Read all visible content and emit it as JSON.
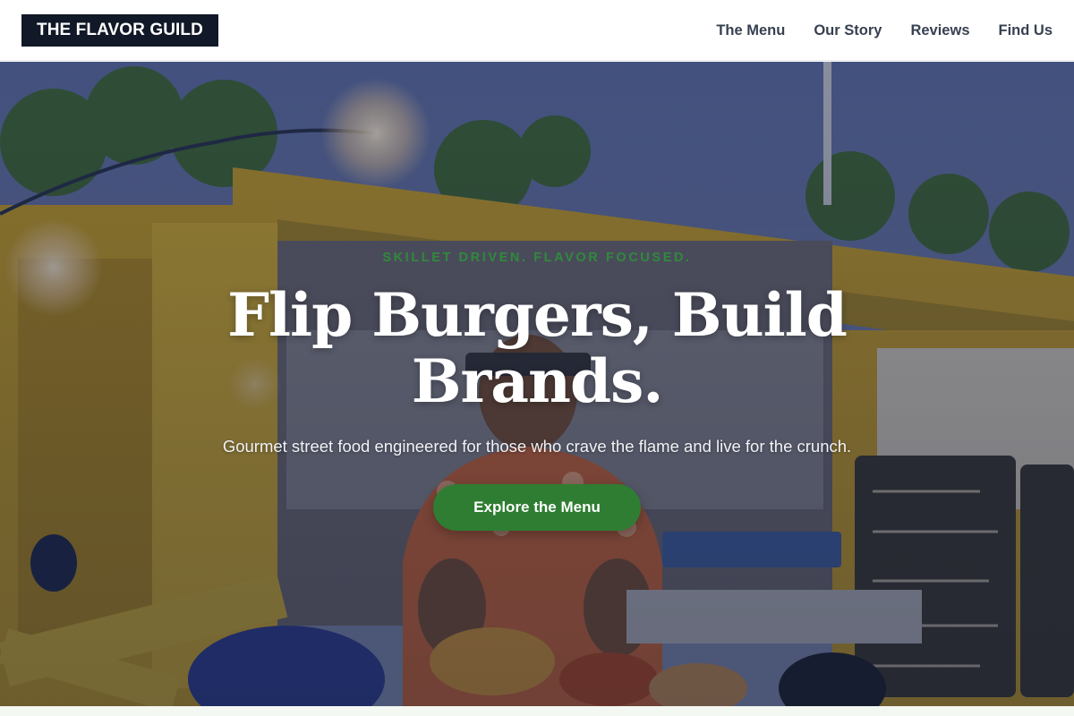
{
  "header": {
    "logo": "THE FLAVOR GUILD",
    "nav": [
      {
        "label": "The Menu"
      },
      {
        "label": "Our Story"
      },
      {
        "label": "Reviews"
      },
      {
        "label": "Find Us"
      }
    ]
  },
  "hero": {
    "eyebrow": "SKILLET DRIVEN. FLAVOR FOCUSED.",
    "title": "Flip Burgers, Build Brands.",
    "subtitle": "Gourmet street food engineered for those who crave the flame and live for the crunch.",
    "cta_label": "Explore the Menu"
  },
  "colors": {
    "logo_bg": "#111827",
    "accent": "#2f7d32",
    "eyebrow": "#2f8a3c"
  }
}
